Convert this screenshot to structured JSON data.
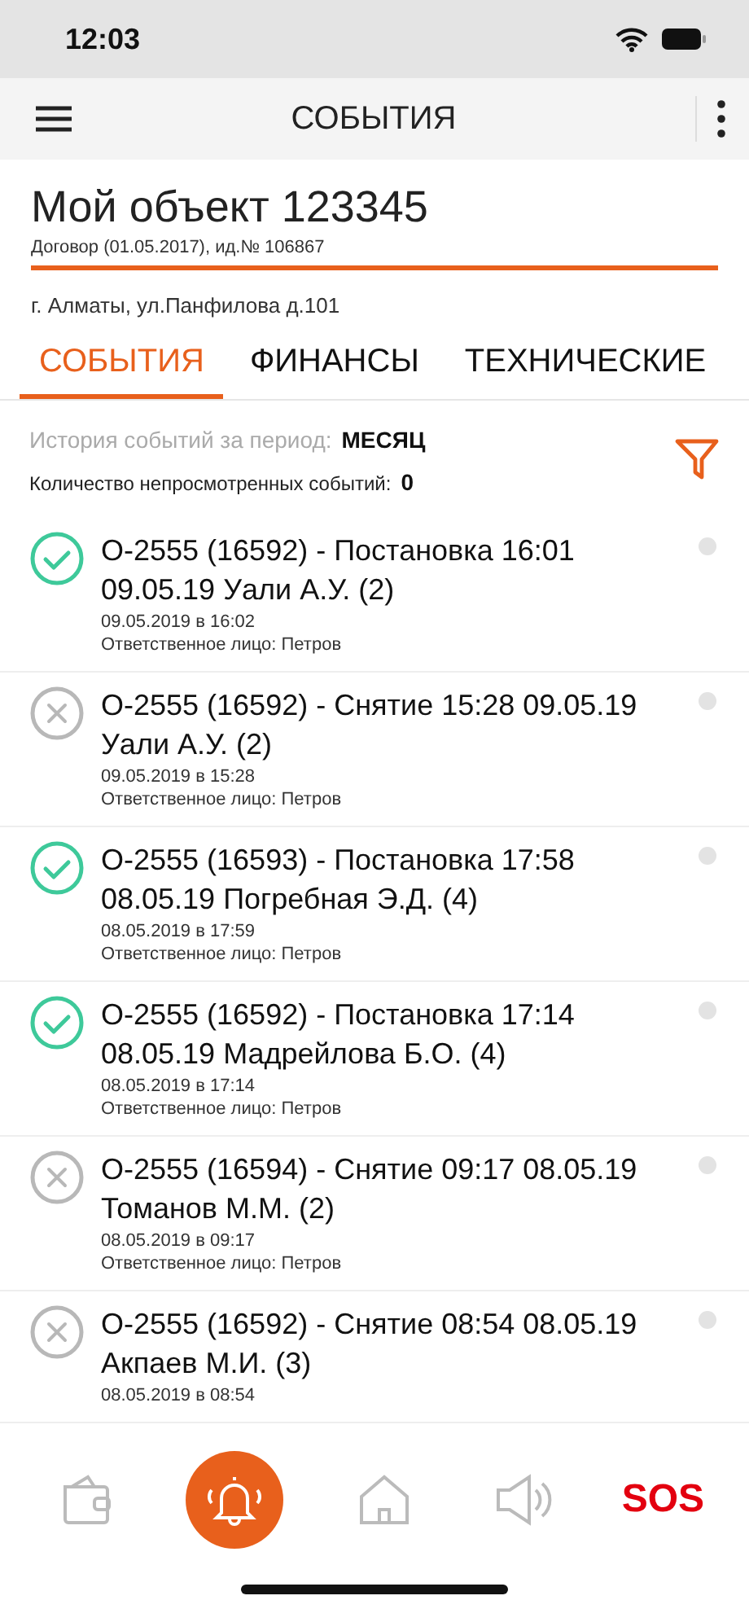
{
  "status_bar": {
    "time": "12:03"
  },
  "app_bar": {
    "title": "СОБЫТИЯ"
  },
  "object": {
    "name": "Мой объект 123345",
    "contract": "Договор  (01.05.2017), ид.№ 106867",
    "address": "г. Алматы, ул.Панфилова д.101"
  },
  "tabs": [
    {
      "label": "СОБЫТИЯ",
      "selected": true
    },
    {
      "label": "ФИНАНСЫ",
      "selected": false
    },
    {
      "label": "ТЕХНИЧЕСКИЕ",
      "selected": false
    }
  ],
  "filter": {
    "label": "История событий за период:",
    "period": "МЕСЯЦ",
    "unread_label": "Количество непросмотренных событий:",
    "unread_count": "0"
  },
  "events": [
    {
      "kind": "armed",
      "title": "О-2555 (16592) - Постановка 16:01 09.05.19 Уали А.У. (2)",
      "time": "09.05.2019 в 16:02",
      "person": "Ответственное лицо: Петров"
    },
    {
      "kind": "disarmed",
      "title": "О-2555 (16592) - Снятие 15:28 09.05.19 Уали А.У. (2)",
      "time": "09.05.2019 в 15:28",
      "person": "Ответственное лицо: Петров"
    },
    {
      "kind": "armed",
      "title": "О-2555 (16593) - Постановка 17:58 08.05.19 Погребная Э.Д. (4)",
      "time": "08.05.2019 в 17:59",
      "person": "Ответственное лицо: Петров"
    },
    {
      "kind": "armed",
      "title": "О-2555 (16592) - Постановка 17:14 08.05.19 Мадрейлова Б.О. (4)",
      "time": "08.05.2019 в 17:14",
      "person": "Ответственное лицо: Петров"
    },
    {
      "kind": "disarmed",
      "title": "О-2555 (16594) - Снятие 09:17 08.05.19 Томанов М.М. (2)",
      "time": "08.05.2019 в 09:17",
      "person": "Ответственное лицо: Петров"
    },
    {
      "kind": "disarmed",
      "title": "О-2555 (16592) - Снятие 08:54 08.05.19 Акпаев М.И. (3)",
      "time": "08.05.2019 в 08:54"
    }
  ],
  "bottom_nav": [
    {
      "kind": "wallet",
      "selected": false
    },
    {
      "kind": "bell",
      "selected": true
    },
    {
      "kind": "home",
      "selected": false
    },
    {
      "kind": "speaker",
      "selected": false
    },
    {
      "kind": "sos",
      "label": "SOS",
      "selected": false
    }
  ]
}
